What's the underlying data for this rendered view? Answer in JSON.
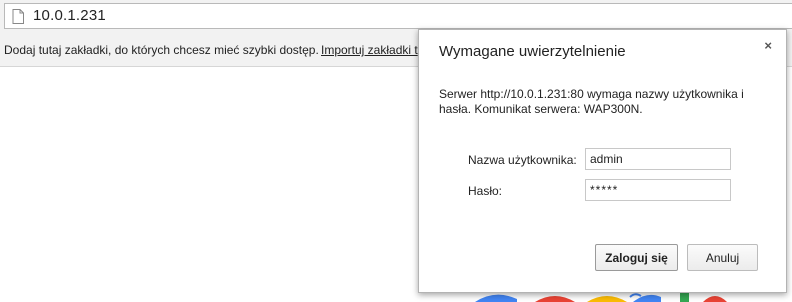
{
  "address_bar": {
    "url": "10.0.1.231"
  },
  "bookmarks_bar": {
    "message": "Dodaj tutaj zakładki, do których chcesz mieć szybki dostęp.",
    "import_link": "Importuj zakładki t"
  },
  "auth_dialog": {
    "title": "Wymagane uwierzytelnienie",
    "close_glyph": "×",
    "message": "Serwer http://10.0.1.231:80 wymaga nazwy użytkownika i hasła. Komunikat serwera: WAP300N.",
    "username_label": "Nazwa użytkownika:",
    "username_value": "admin",
    "password_label": "Hasło:",
    "password_value": "*****",
    "login_button": "Zaloguj się",
    "cancel_button": "Anuluj"
  },
  "colors": {
    "chrome_bg": "#f2f2f2",
    "logo_blue": "#4285f4",
    "logo_red": "#ea4335",
    "logo_yellow": "#fbbc05",
    "logo_green": "#34a853"
  }
}
